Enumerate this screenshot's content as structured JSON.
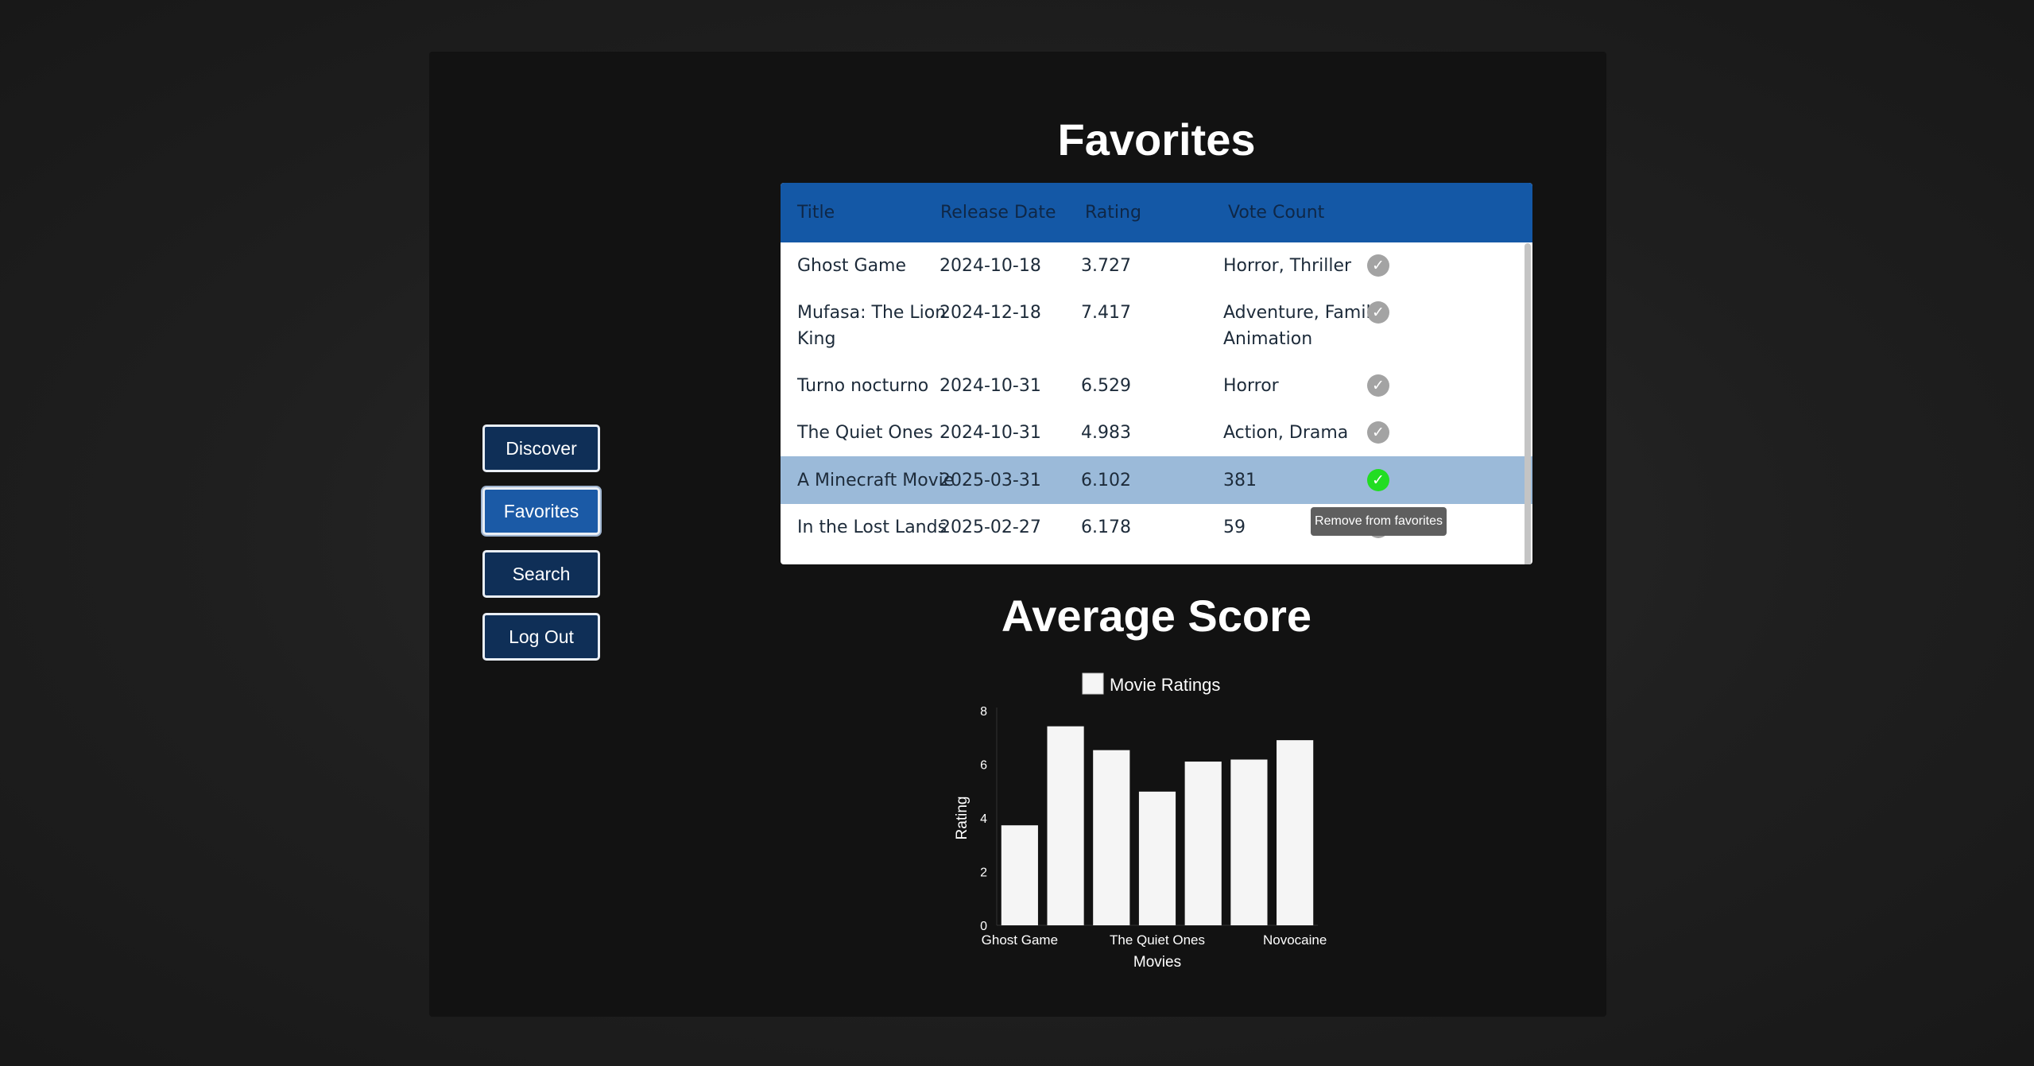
{
  "nav": {
    "discover": "Discover",
    "favorites": "Favorites",
    "search": "Search",
    "logout": "Log Out"
  },
  "page": {
    "title": "Favorites",
    "chart_title": "Average Score"
  },
  "table": {
    "headers": [
      "Title",
      "Release Date",
      "Rating",
      "Vote Count"
    ],
    "rows": [
      {
        "title": "Ghost Game",
        "title2": "",
        "date": "2024-10-18",
        "rating": "3.727",
        "extra": "Horror, Thriller",
        "extra2": "",
        "favorited": true
      },
      {
        "title": "Mufasa: The Lion",
        "title2": "King",
        "date": "2024-12-18",
        "rating": "7.417",
        "extra": "Adventure, Family,",
        "extra2": "Animation",
        "favorited": true
      },
      {
        "title": "Turno nocturno",
        "title2": "",
        "date": "2024-10-31",
        "rating": "6.529",
        "extra": "Horror",
        "extra2": "",
        "favorited": true
      },
      {
        "title": "The Quiet Ones",
        "title2": "",
        "date": "2024-10-31",
        "rating": "4.983",
        "extra": "Action, Drama",
        "extra2": "",
        "favorited": true
      },
      {
        "title": "A Minecraft Movie",
        "title2": "",
        "date": "2025-03-31",
        "rating": "6.102",
        "extra": "381",
        "extra2": "",
        "favorited": true
      },
      {
        "title": "In the Lost Lands",
        "title2": "",
        "date": "2025-02-27",
        "rating": "6.178",
        "extra": "59",
        "extra2": "",
        "favorited": true
      }
    ],
    "tooltip": "Remove from favorites",
    "check_glyph": "✓"
  },
  "colors": {
    "header_bg": "#1458a6",
    "highlight_row": "#9bbad9",
    "check_active": "#22dd22",
    "check_inactive": "#a3a3a3"
  },
  "chart_data": {
    "type": "bar",
    "legend": "Movie Ratings",
    "xlabel": "Movies",
    "ylabel": "Rating",
    "ylim": [
      0,
      8
    ],
    "yticks": [
      0,
      2,
      4,
      6,
      8
    ],
    "categories": [
      "Ghost Game",
      "Mufasa: The Lion King",
      "Turno nocturno",
      "The Quiet Ones",
      "A Minecraft Movie",
      "In the Lost Lands",
      "Novocaine"
    ],
    "visible_xtick_labels": [
      "Ghost Game",
      "The Quiet Ones",
      "Novocaine"
    ],
    "values": [
      3.727,
      7.417,
      6.529,
      4.983,
      6.102,
      6.178,
      6.9
    ],
    "bar_color": "#f5f5f5"
  }
}
